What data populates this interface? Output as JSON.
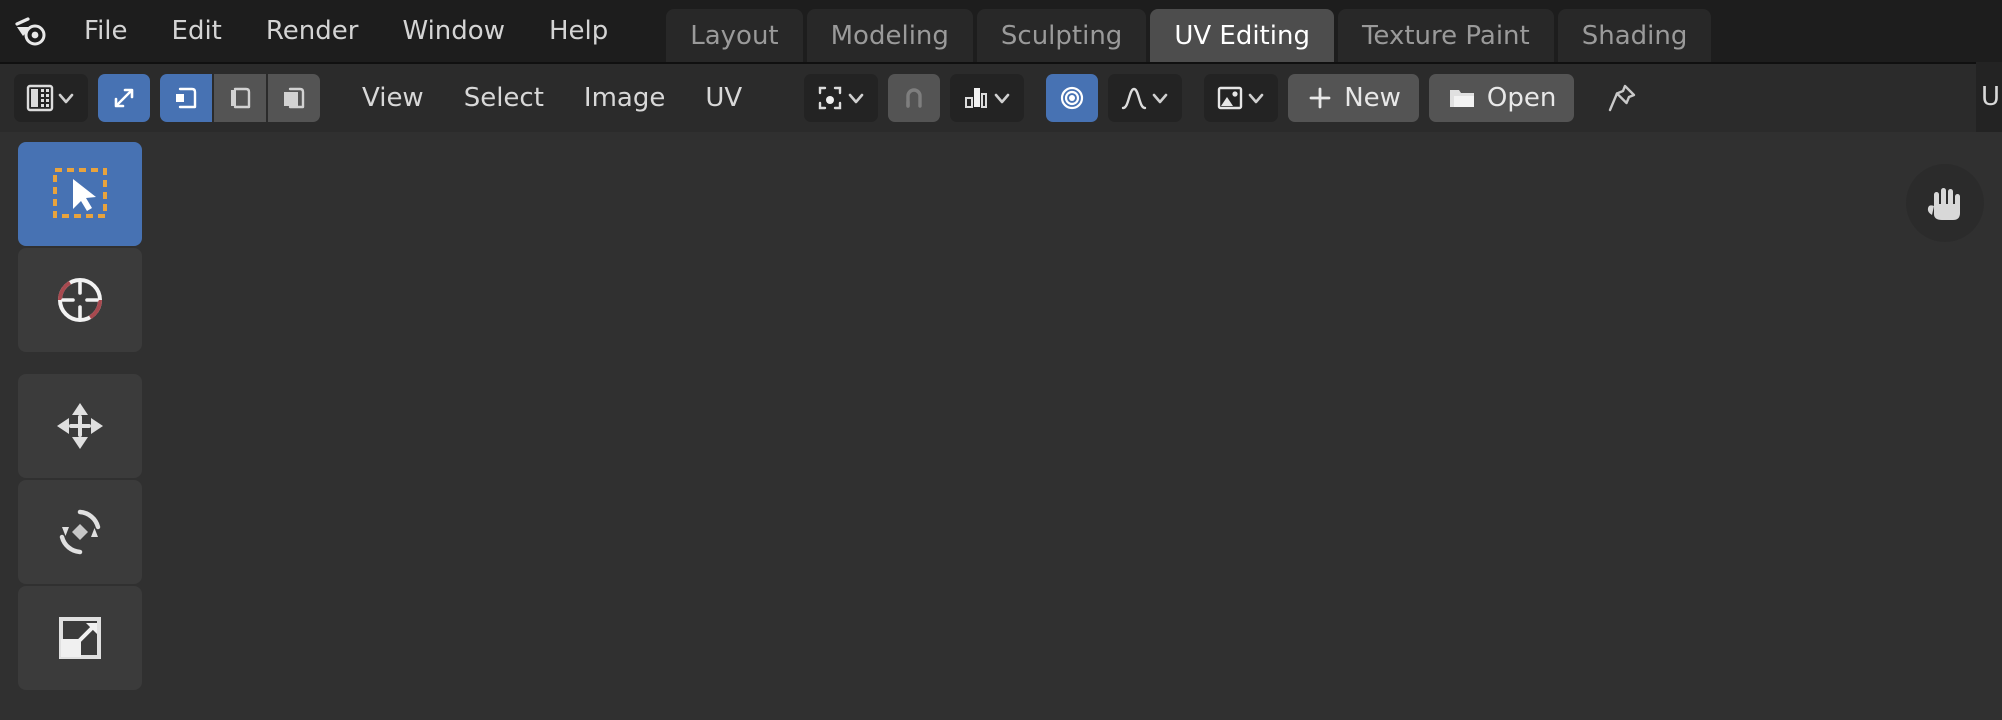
{
  "app": {
    "name": "Blender",
    "logo_icon": "blender-logo-icon",
    "theme": {
      "topbar_bg": "#1d1d1d",
      "header_bg": "#2b2b2b",
      "canvas_bg": "#303030",
      "accent_blue": "#4772b3",
      "button_grey": "#545454",
      "button_dark": "#282828",
      "text": "#d4d4d4",
      "text_active": "#ffffff",
      "text_muted": "#9a9a9a"
    }
  },
  "topbar": {
    "menus": [
      {
        "label": "File"
      },
      {
        "label": "Edit"
      },
      {
        "label": "Render"
      },
      {
        "label": "Window"
      },
      {
        "label": "Help"
      }
    ],
    "workspace_tabs": [
      {
        "label": "Layout",
        "active": false
      },
      {
        "label": "Modeling",
        "active": false
      },
      {
        "label": "Sculpting",
        "active": false
      },
      {
        "label": "UV Editing",
        "active": true
      },
      {
        "label": "Texture Paint",
        "active": false
      },
      {
        "label": "Shading",
        "active": false
      }
    ],
    "active_workspace": "UV Editing"
  },
  "editor_header": {
    "editor_type": {
      "icon": "uv-editor-type-icon",
      "dropdown_icon": "chevron-down-icon"
    },
    "uv_sync_selection": {
      "icon": "uv-sync-selection-icon",
      "enabled": true
    },
    "select_modes": [
      {
        "name": "vertex",
        "icon": "uv-select-vertex-icon",
        "active": true
      },
      {
        "name": "edge",
        "icon": "uv-select-edge-icon",
        "active": false
      },
      {
        "name": "face",
        "icon": "uv-select-face-icon",
        "active": false
      }
    ],
    "menus": [
      {
        "label": "View"
      },
      {
        "label": "Select"
      },
      {
        "label": "Image"
      },
      {
        "label": "UV"
      }
    ],
    "pivot_point": {
      "icon": "pivot-point-icon",
      "dropdown_icon": "chevron-down-icon"
    },
    "snap_magnet": {
      "icon": "snap-magnet-icon",
      "enabled": false
    },
    "snap_target": {
      "icon": "snap-increment-icon",
      "dropdown_icon": "chevron-down-icon"
    },
    "proportional_editing": {
      "icon": "proportional-editing-icon",
      "enabled": true
    },
    "proportional_falloff": {
      "icon": "falloff-smooth-icon",
      "dropdown_icon": "chevron-down-icon"
    },
    "image_datablock": {
      "icon": "image-datablock-icon",
      "dropdown_icon": "chevron-down-icon",
      "new_icon": "plus-icon",
      "new_label": "New",
      "open_icon": "folder-icon",
      "open_label": "Open",
      "pin_icon": "pin-icon"
    },
    "overflow_text": "U"
  },
  "toolbar": {
    "tools": [
      {
        "name": "tweak",
        "icon": "tweak-select-box-icon",
        "active": true
      },
      {
        "name": "cursor",
        "icon": "cursor-2d-icon",
        "active": false
      },
      {
        "name": "move",
        "icon": "move-icon",
        "active": false
      },
      {
        "name": "rotate",
        "icon": "rotate-icon",
        "active": false
      },
      {
        "name": "scale",
        "icon": "scale-icon",
        "active": false
      }
    ]
  },
  "canvas": {
    "navigate_gizmo_icon": "hand-pan-icon",
    "background_color": "#303030"
  }
}
